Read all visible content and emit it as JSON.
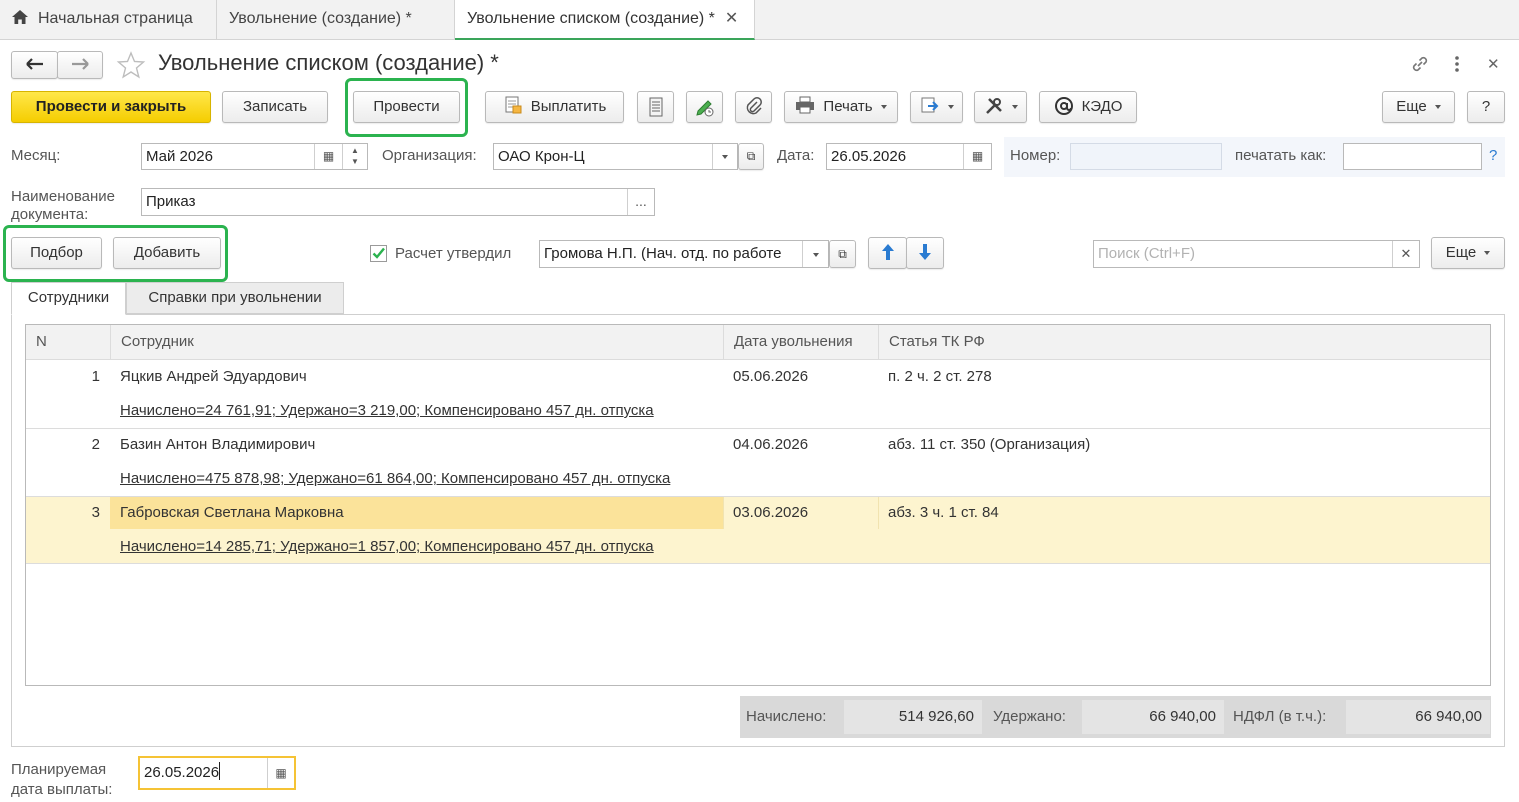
{
  "tabs": [
    {
      "label": "Начальная страница"
    },
    {
      "label": "Увольнение (создание) *"
    },
    {
      "label": "Увольнение списком (создание) *"
    }
  ],
  "title": "Увольнение списком (создание) *",
  "toolbar": {
    "post_close": "Провести и закрыть",
    "save": "Записать",
    "post": "Провести",
    "pay": "Выплатить",
    "print": "Печать",
    "kedo": "КЭДО",
    "more": "Еще",
    "help": "?"
  },
  "form": {
    "month_label": "Месяц:",
    "month_value": "Май 2026",
    "org_label": "Организация:",
    "org_value": "ОАО Крон-Ц",
    "date_label": "Дата:",
    "date_value": "26.05.2026",
    "number_label": "Номер:",
    "print_as_label": "печатать как:",
    "help": "?",
    "docname_label_1": "Наименование",
    "docname_label_2": "документа:",
    "docname_value": "Приказ",
    "select_button": "Подбор",
    "add_button": "Добавить",
    "approved_label": "Расчет утвердил",
    "approved_value": "Громова Н.П. (Нач. отд. по работе",
    "search_placeholder": "Поиск (Ctrl+F)",
    "more": "Еще"
  },
  "subtabs": [
    "Сотрудники",
    "Справки при увольнении"
  ],
  "table": {
    "headers": [
      "N",
      "Сотрудник",
      "Дата увольнения",
      "Статья ТК РФ"
    ],
    "rows": [
      {
        "n": "1",
        "employee": "Яцкив Андрей Эдуардович",
        "date": "05.06.2026",
        "article": "п. 2 ч. 2 ст. 278",
        "details": "Начислено=24 761,91; Удержано=3 219,00; Компенсировано 457 дн. отпуска"
      },
      {
        "n": "2",
        "employee": "Базин Антон Владимирович",
        "date": "04.06.2026",
        "article": "абз. 11 ст. 350 (Организация)",
        "details": "Начислено=475 878,98; Удержано=61 864,00; Компенсировано 457 дн. отпуска"
      },
      {
        "n": "3",
        "employee": "Габровская Светлана Марковна",
        "date": "03.06.2026",
        "article": "абз. 3 ч. 1 ст. 84",
        "details": "Начислено=14 285,71; Удержано=1 857,00; Компенсировано 457 дн. отпуска"
      }
    ]
  },
  "totals": {
    "accrued_label": "Начислено:",
    "accrued_value": "514 926,60",
    "withheld_label": "Удержано:",
    "withheld_value": "66 940,00",
    "ndfl_label": "НДФЛ (в т.ч.):",
    "ndfl_value": "66 940,00"
  },
  "footer": {
    "pay_date_label_1": "Планируемая",
    "pay_date_label_2": "дата выплаты:",
    "pay_date_value": "26.05.2026"
  },
  "colors": {
    "accent_green": "#2bb34f",
    "primary_yellow": "#f5cd00",
    "selected_row": "#fdf4cf",
    "selected_cell": "#fbe39a"
  }
}
